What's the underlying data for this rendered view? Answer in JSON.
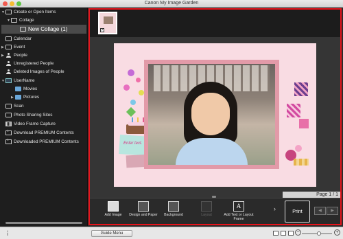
{
  "window": {
    "title": "Canon My Image Garden"
  },
  "sidebar": {
    "items": [
      {
        "label": "Create or Open Items",
        "indent": 0,
        "expanded": true,
        "icon": "create-icon"
      },
      {
        "label": "Collage",
        "indent": 1,
        "expanded": true,
        "icon": "collage-icon"
      },
      {
        "label": "New Collage (1)",
        "indent": 2,
        "selected": true,
        "icon": "item-icon"
      },
      {
        "label": "Calendar",
        "indent": 0,
        "icon": "calendar-icon"
      },
      {
        "label": "Event",
        "indent": 0,
        "collapsed": true,
        "icon": "event-icon"
      },
      {
        "label": "People",
        "indent": 0,
        "collapsed": true,
        "icon": "person-icon"
      },
      {
        "label": "Unregistered People",
        "indent": 0,
        "icon": "person-icon"
      },
      {
        "label": "Deleted Images of People",
        "indent": 0,
        "icon": "person-icon"
      },
      {
        "label": "UserName",
        "indent": 0,
        "expanded": true,
        "icon": "computer-icon"
      },
      {
        "label": "Movies",
        "indent": 1,
        "icon": "folder-icon"
      },
      {
        "label": "Pictures",
        "indent": 1,
        "collapsed": true,
        "icon": "folder-icon"
      },
      {
        "label": "Scan",
        "indent": 0,
        "icon": "scan-icon"
      },
      {
        "label": "Photo Sharing Sites",
        "indent": 0,
        "icon": "share-icon"
      },
      {
        "label": "Video Frame Capture",
        "indent": 0,
        "icon": "film-icon"
      },
      {
        "label": "Download PREMIUM Contents",
        "indent": 0,
        "icon": "download-icon"
      },
      {
        "label": "Downloaded PREMIUM Contents",
        "indent": 0,
        "icon": "download-icon"
      }
    ]
  },
  "canvas": {
    "note_text": "Enter text.",
    "page_indicator": "Page 1 / 1"
  },
  "toolbar": {
    "add_image": "Add Image",
    "design_and_paper": "Design and Paper",
    "background": "Background",
    "layout": "Layout",
    "add_text": "Add Text or Layout Frame",
    "print": "Print"
  },
  "bottom": {
    "guide_menu": "Guide Menu"
  },
  "colors": {
    "highlight_frame": "#e8141c",
    "page": "#f9dce3"
  }
}
